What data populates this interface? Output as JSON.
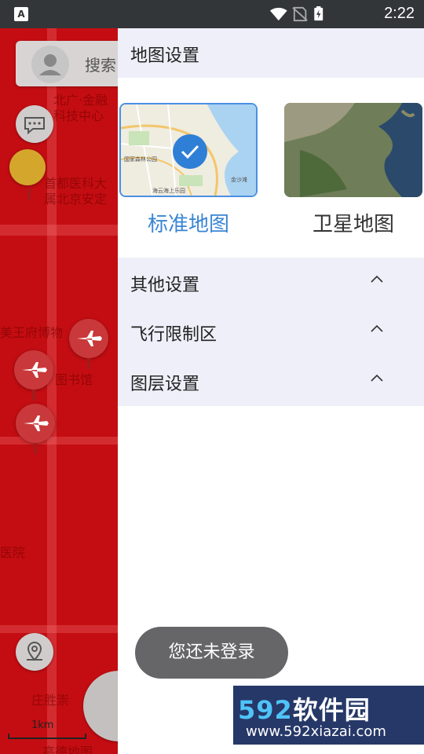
{
  "status_bar": {
    "time": "2:22",
    "app_icon_letter": "A"
  },
  "map": {
    "search_placeholder": "搜索",
    "labels": [
      "北广·金融",
      "科技中心",
      "首都医科大",
      "属北京安定",
      "美王府博物",
      "图书馆",
      "医院",
      "庄胜崇",
      "高德地图"
    ],
    "scale_label": "1km"
  },
  "drawer": {
    "title": "地图设置",
    "map_types": [
      {
        "label": "标准地图",
        "selected": true,
        "thumb_labels": [
          "国家森林公园",
          "海云海上乐园",
          "金沙滩"
        ]
      },
      {
        "label": "卫星地图",
        "selected": false
      }
    ],
    "settings": [
      {
        "label": "其他设置"
      },
      {
        "label": "飞行限制区"
      },
      {
        "label": "图层设置"
      }
    ]
  },
  "toast": {
    "text": "您还未登录"
  },
  "watermark": {
    "brand_digits": "592",
    "brand_cn": "软件园",
    "url": "www.592xiazai.com"
  },
  "colors": {
    "map_red": "#c40d12",
    "accent_blue": "#3a86d4",
    "drawer_header_bg": "#eeeff8",
    "status_bar_bg": "#333639"
  }
}
